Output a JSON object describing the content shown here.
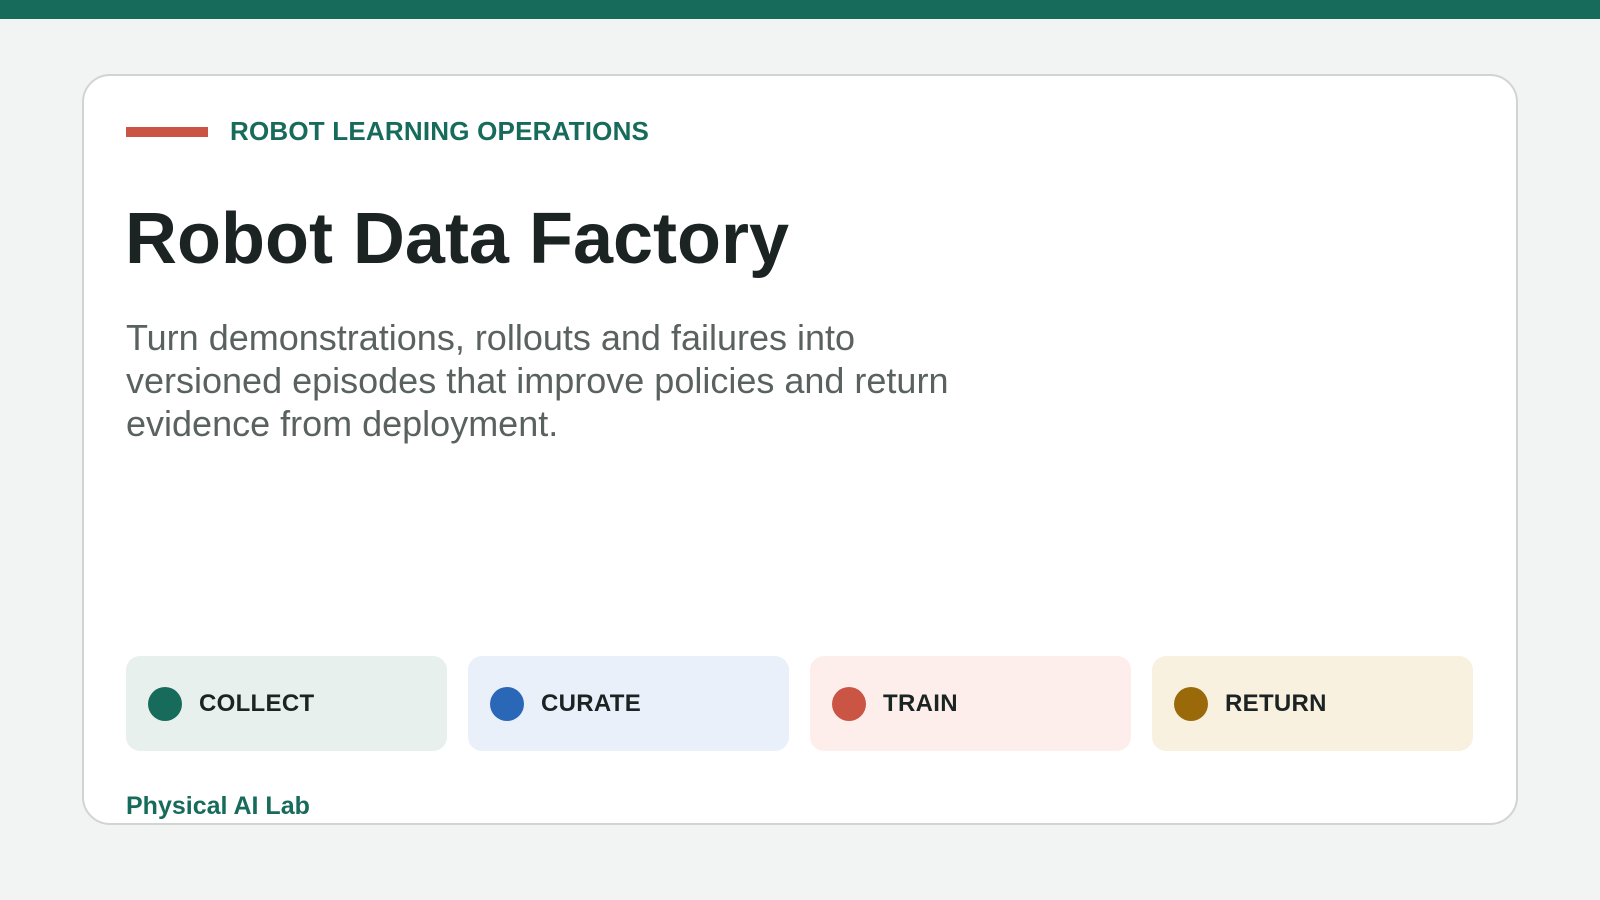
{
  "colors": {
    "brand": "#176b5a",
    "accent": "#cb5545",
    "background": "#f2f4f3",
    "card": "#ffffff"
  },
  "header": {
    "eyebrow": "ROBOT LEARNING OPERATIONS",
    "title": "Robot Data Factory",
    "subtitle": "Turn demonstrations, rollouts and failures into versioned episodes that improve policies and return evidence from deployment."
  },
  "stages": [
    {
      "label": "COLLECT",
      "dot_color": "#176b5a",
      "background": "#e7f0ed"
    },
    {
      "label": "CURATE",
      "dot_color": "#2a67b6",
      "background": "#e9f0fa"
    },
    {
      "label": "TRAIN",
      "dot_color": "#cb5545",
      "background": "#fdeeeb"
    },
    {
      "label": "RETURN",
      "dot_color": "#9a6a0a",
      "background": "#f9f1e0"
    }
  ],
  "footer": {
    "brand": "Physical AI Lab"
  }
}
